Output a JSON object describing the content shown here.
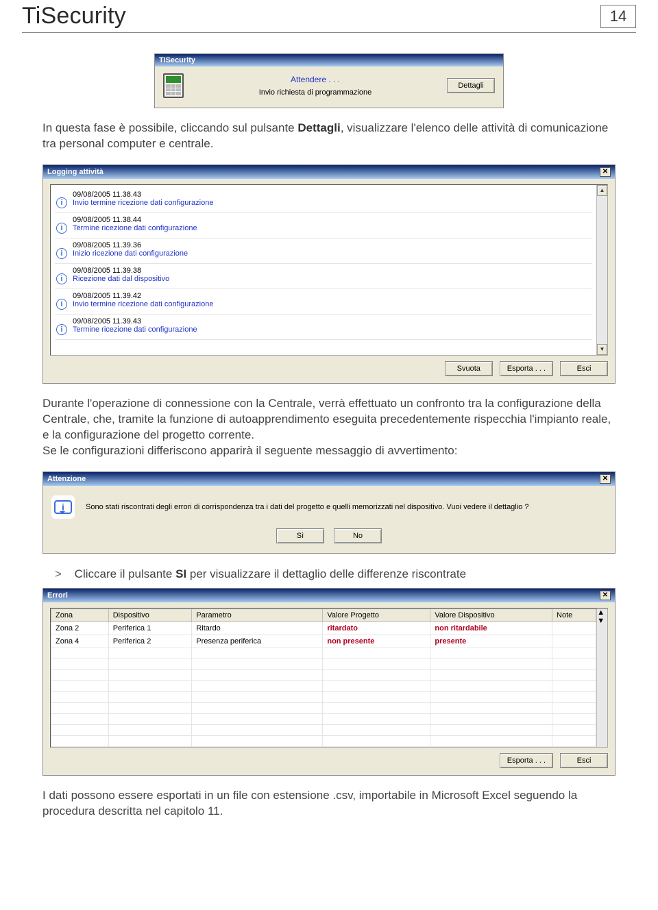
{
  "header": {
    "title": "TiSecurity",
    "page_number": "14"
  },
  "para1_a": "In questa fase è possibile, cliccando sul pulsante ",
  "para1_bold": "Dettagli",
  "para1_b": ", visualizzare l'elenco delle attività di comunicazione tra personal computer e centrale.",
  "dlg_small": {
    "title": "TiSecurity",
    "wait": "Attendere . . .",
    "subtitle": "Invio richiesta di programmazione",
    "button": "Dettagli"
  },
  "logging": {
    "title": "Logging attività",
    "entries": [
      {
        "ts": "09/08/2005 11.38.43",
        "msg": "Invio termine ricezione dati configurazione"
      },
      {
        "ts": "09/08/2005 11.38.44",
        "msg": "Termine ricezione dati configurazione"
      },
      {
        "ts": "09/08/2005 11.39.36",
        "msg": "Inizio ricezione dati configurazione"
      },
      {
        "ts": "09/08/2005 11.39.38",
        "msg": "Ricezione dati dal dispositivo"
      },
      {
        "ts": "09/08/2005 11.39.42",
        "msg": "Invio termine ricezione dati configurazione"
      },
      {
        "ts": "09/08/2005 11.39.43",
        "msg": "Termine ricezione dati configurazione"
      }
    ],
    "buttons": {
      "empty": "Svuota",
      "export": "Esporta . . .",
      "exit": "Esci"
    }
  },
  "para2": "Durante l'operazione di connessione con la Centrale, verrà effettuato un confronto tra la configurazione della Centrale, che, tramite la funzione di autoapprendimento eseguita precedentemente rispecchia l'impianto reale, e la configurazione del progetto corrente.\nSe le configurazioni differiscono apparirà il seguente messaggio di avvertimento:",
  "attention": {
    "title": "Attenzione",
    "message": "Sono stati riscontrati degli errori di corrispondenza tra i dati del progetto e quelli memorizzati nel dispositivo. Vuoi vedere il dettaglio ?",
    "yes": "Sì",
    "no": "No"
  },
  "step_a": "Cliccare il pulsante ",
  "step_bold": "SI",
  "step_b": " per visualizzare il dettaglio delle differenze riscontrate",
  "errors": {
    "title": "Errori",
    "headers": [
      "Zona",
      "Dispositivo",
      "Parametro",
      "Valore Progetto",
      "Valore Dispositivo",
      "Note"
    ],
    "rows": [
      {
        "zona": "Zona 2",
        "dispositivo": "Periferica 1",
        "parametro": "Ritardo",
        "valore_progetto": "ritardato",
        "valore_dispositivo": "non ritardabile",
        "note": ""
      },
      {
        "zona": "Zona 4",
        "dispositivo": "Periferica 2",
        "parametro": "Presenza periferica",
        "valore_progetto": "non presente",
        "valore_dispositivo": "presente",
        "note": ""
      }
    ],
    "buttons": {
      "export": "Esporta . . .",
      "exit": "Esci"
    }
  },
  "para3": "I dati possono essere esportati in un file con estensione .csv, importabile in Microsoft Excel seguendo la procedura descritta nel capitolo 11."
}
